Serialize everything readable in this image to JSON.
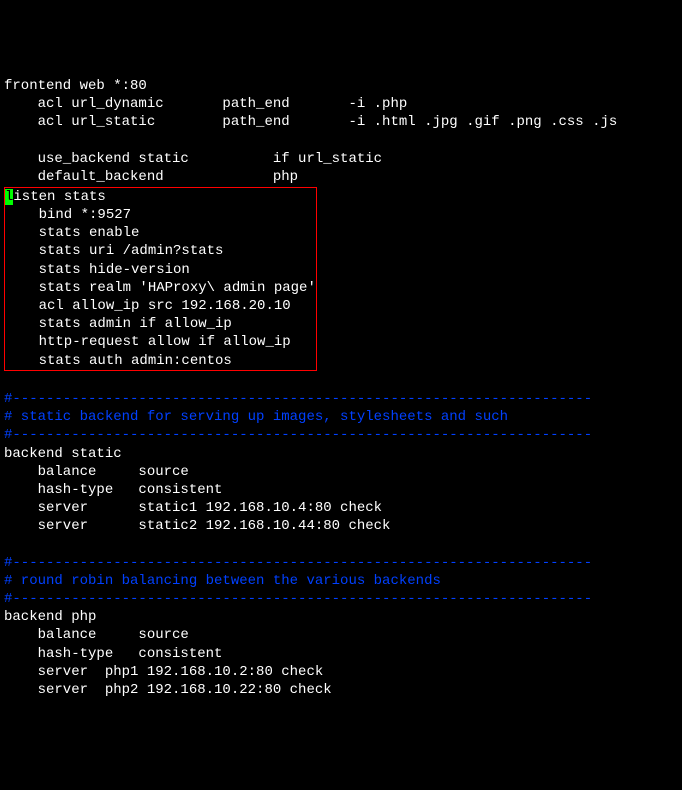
{
  "frontend": {
    "title": "frontend web *:80",
    "acl1": "    acl url_dynamic       path_end       -i .php",
    "acl2": "    acl url_static        path_end       -i .html .jpg .gif .png .css .js",
    "use_backend": "    use_backend static          if url_static",
    "default_backend": "    default_backend             php"
  },
  "listen_stats": {
    "cursor_char": "l",
    "line1_rest": "isten stats",
    "line2": "    bind *:9527",
    "line3": "    stats enable",
    "line4": "    stats uri /admin?stats",
    "line5": "    stats hide-version",
    "line6": "    stats realm 'HAProxy\\ admin page'",
    "line7": "    acl allow_ip src 192.168.20.10",
    "line8": "    stats admin if allow_ip",
    "line9": "    http-request allow if allow_ip",
    "line10": "    stats auth admin:centos"
  },
  "comment1": {
    "dashes1": "#---------------------------------------------------------------------",
    "text": "# static backend for serving up images, stylesheets and such",
    "dashes2": "#---------------------------------------------------------------------"
  },
  "backend_static": {
    "title": "backend static",
    "balance": "    balance     source",
    "hash": "    hash-type   consistent",
    "server1": "    server      static1 192.168.10.4:80 check",
    "server2": "    server      static2 192.168.10.44:80 check"
  },
  "comment2": {
    "dashes1": "#---------------------------------------------------------------------",
    "text": "# round robin balancing between the various backends",
    "dashes2": "#---------------------------------------------------------------------"
  },
  "backend_php": {
    "title": "backend php",
    "balance": "    balance     source",
    "hash": "    hash-type   consistent",
    "server1": "    server  php1 192.168.10.2:80 check",
    "server2": "    server  php2 192.168.10.22:80 check"
  }
}
